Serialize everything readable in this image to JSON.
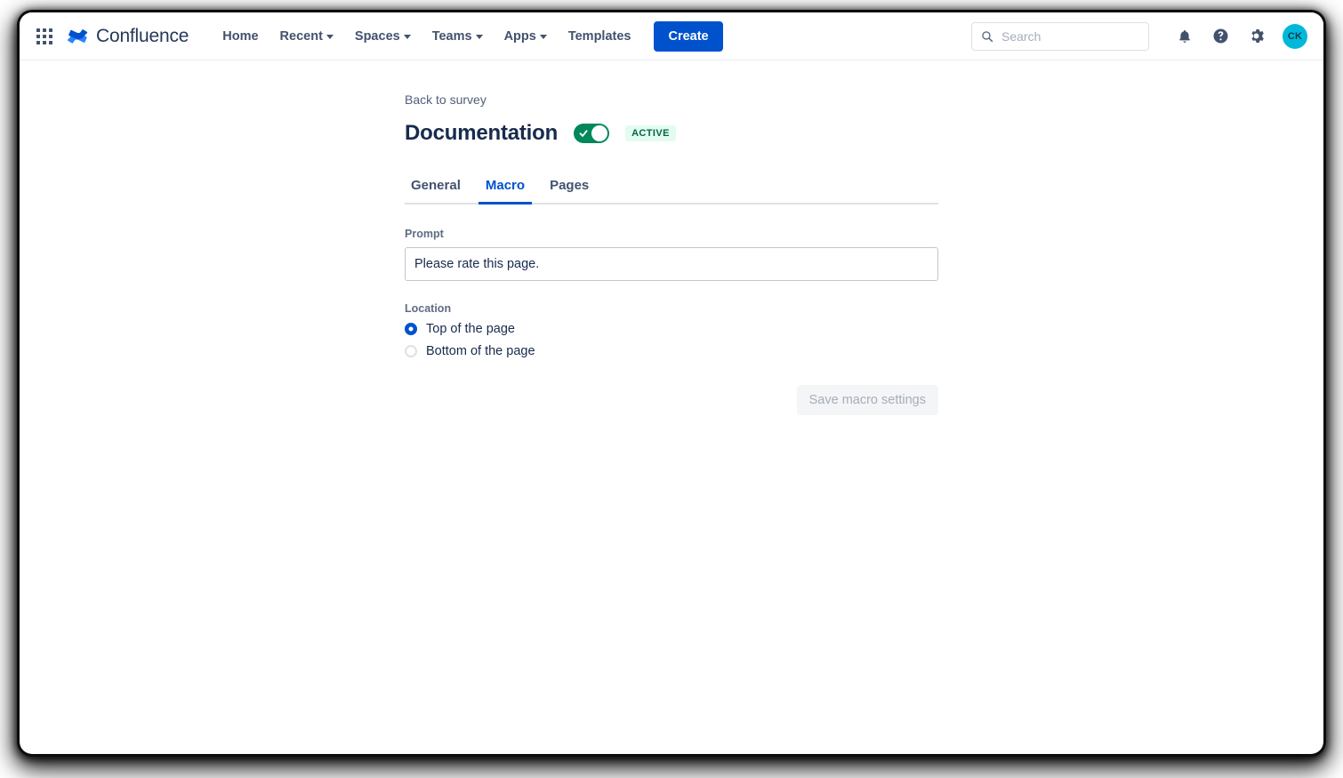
{
  "nav": {
    "app_switcher": "app-switcher",
    "brand": "Confluence",
    "items": [
      {
        "label": "Home",
        "has_caret": false
      },
      {
        "label": "Recent",
        "has_caret": true
      },
      {
        "label": "Spaces",
        "has_caret": true
      },
      {
        "label": "Teams",
        "has_caret": true
      },
      {
        "label": "Apps",
        "has_caret": true
      },
      {
        "label": "Templates",
        "has_caret": false
      }
    ],
    "create_label": "Create",
    "search_placeholder": "Search",
    "search_value": "",
    "icons": [
      "notifications-icon",
      "help-icon",
      "settings-icon"
    ],
    "avatar_initials": "CK"
  },
  "page": {
    "back_link": "Back to survey",
    "title": "Documentation",
    "toggle_on": true,
    "status_badge": "ACTIVE"
  },
  "tabs": [
    {
      "label": "General",
      "active": false
    },
    {
      "label": "Macro",
      "active": true
    },
    {
      "label": "Pages",
      "active": false
    }
  ],
  "form": {
    "prompt_label": "Prompt",
    "prompt_value": "Please rate this page.",
    "prompt_placeholder": "",
    "location_label": "Location",
    "location_options": [
      {
        "label": "Top of the page",
        "selected": true
      },
      {
        "label": "Bottom of the page",
        "selected": false
      }
    ],
    "save_label": "Save macro settings",
    "save_disabled": true
  },
  "colors": {
    "primary_blue": "#0052cc",
    "toggle_green": "#00875a",
    "badge_bg": "#e3fcef",
    "badge_text": "#006644",
    "avatar_bg": "#00b8d9",
    "text_dark": "#172b4d"
  }
}
